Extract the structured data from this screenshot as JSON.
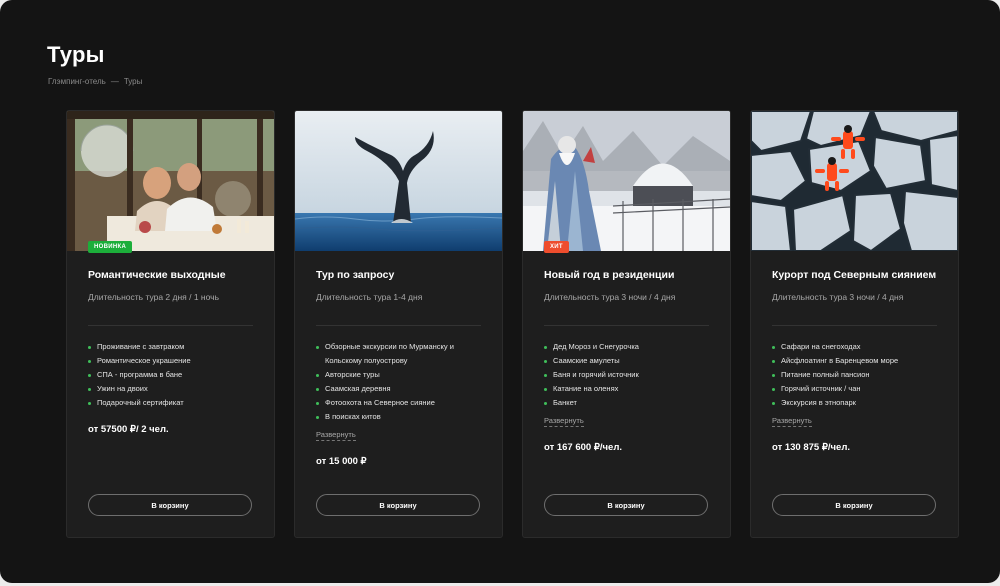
{
  "page": {
    "title": "Туры",
    "breadcrumb": {
      "home": "Глэмпинг-отель",
      "separator": "—",
      "current": "Туры"
    }
  },
  "colors": {
    "background": "#141414",
    "card": "#1e1e1e",
    "bullet": "#3fbf5a",
    "badge_new": "#1cae3a",
    "badge_hit": "#ee4d2d"
  },
  "cards": [
    {
      "badge": "Новинка",
      "name": "Романтические выходные",
      "duration": "Длительность тура 2 дня / 1 ночь",
      "features": [
        "Проживание с завтраком",
        "Романтическое украшение",
        "СПА - программа в бане",
        "Ужин на двоих",
        "Подарочный сертификат"
      ],
      "expand": "",
      "price": "от 57500 ₽/ 2 чел.",
      "button": "В корзину"
    },
    {
      "badge": "",
      "name": "Тур по запросу",
      "duration": "Длительность тура 1-4 дня",
      "features": [
        "Обзорные экскурсии по Мурманску и Кольскому полуострову",
        "Авторские туры",
        "Саамская деревня",
        "Фотоохота на Северное сияние",
        "В поисках китов"
      ],
      "expand": "Развернуть",
      "price": "от 15 000 ₽",
      "button": "В корзину"
    },
    {
      "badge": "Хит",
      "name": "Новый год в резиденции",
      "duration": "Длительность тура 3 ночи / 4 дня",
      "features": [
        "Дед Мороз и Снегурочка",
        "Саамские амулеты",
        "Баня и горячий источник",
        "Катание на оленях",
        "Банкет"
      ],
      "expand": "Развернуть",
      "price": "от 167 600 ₽/чел.",
      "button": "В корзину"
    },
    {
      "badge": "",
      "name": "Курорт под Северным сиянием",
      "duration": "Длительность тура 3 ночи / 4 дня",
      "features": [
        "Сафари на снегоходах",
        "Айсфлоатинг в Баренцевом море",
        "Питание полный пансион",
        "Горячий источник / чан",
        "Экскурсия в этнопарк"
      ],
      "expand": "Развернуть",
      "price": "от 130 875 ₽/чел.",
      "button": "В корзину"
    }
  ]
}
